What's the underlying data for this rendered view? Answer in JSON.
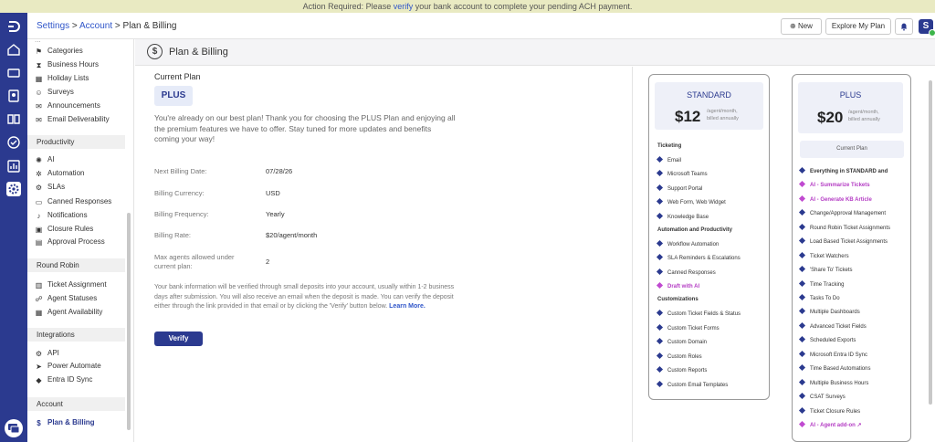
{
  "banner": {
    "prefix": "Action Required: Please ",
    "link": "verify",
    "suffix": " your bank account to complete your pending ACH payment."
  },
  "breadcrumb": {
    "settings": "Settings",
    "sep1": " > ",
    "account": "Account",
    "sep2": " > ",
    "current": "Plan & Billing"
  },
  "topbar": {
    "new_label": "⊕ New",
    "explore_label": "Explore My Plan",
    "avatar_letter": "S"
  },
  "sidebar": {
    "top_partial": "...",
    "items_top": [
      "Categories",
      "Business Hours",
      "Holiday Lists",
      "Surveys",
      "Announcements",
      "Email Deliverability"
    ],
    "productivity_title": "Productivity",
    "productivity_items": [
      "AI",
      "Automation",
      "SLAs",
      "Canned Responses",
      "Notifications",
      "Closure Rules",
      "Approval Process"
    ],
    "roundrobin_title": "Round Robin",
    "roundrobin_items": [
      "Ticket Assignment",
      "Agent Statuses",
      "Agent Availability"
    ],
    "integrations_title": "Integrations",
    "integrations_items": [
      "API",
      "Power Automate",
      "Entra ID Sync"
    ],
    "account_title": "Account",
    "account_items": [
      "Plan & Billing"
    ]
  },
  "page": {
    "title": "Plan & Billing"
  },
  "current_plan": {
    "heading": "Current Plan",
    "badge": "PLUS",
    "description": "You're already on our best plan! Thank you for choosing the PLUS Plan and enjoying all the premium features we have to offer. Stay tuned for more updates and benefits coming your way!",
    "fields": [
      {
        "label": "Next Billing Date:",
        "value": "07/28/26"
      },
      {
        "label": "Billing Currency:",
        "value": "USD"
      },
      {
        "label": "Billing Frequency:",
        "value": "Yearly"
      },
      {
        "label": "Billing Rate:",
        "value": "$20/agent/month"
      },
      {
        "label": "Max agents allowed under current plan:",
        "value": "2"
      }
    ],
    "note": "Your bank information will be verified through small deposits into your account, usually within 1-2 business days after submission. You will also receive an email when the deposit is made. You can verify the deposit either through the link provided in that email or by clicking the 'Verify' button below. ",
    "learn_more": "Learn More.",
    "verify_label": "Verify"
  },
  "plans": {
    "standard": {
      "name": "STANDARD",
      "price": "$12",
      "per1": "/agent/month,",
      "per2": "billed annually",
      "sections": [
        {
          "title": "Ticketing",
          "items": [
            "Email",
            "Microsoft Teams",
            "Support Portal",
            "Web Form, Web Widget",
            "Knowledge Base"
          ]
        },
        {
          "title": "Automation and Productivity",
          "items": [
            "Workflow Automation",
            "SLA Reminders & Escalations",
            "Canned Responses",
            "Draft with AI"
          ]
        },
        {
          "title": "Customizations",
          "items": [
            "Custom Ticket Fields & Status",
            "Custom Ticket Forms",
            "Custom Domain",
            "Custom Roles",
            "Custom Reports",
            "Custom Email Templates"
          ]
        }
      ]
    },
    "plus": {
      "name": "PLUS",
      "price": "$20",
      "per1": "/agent/month,",
      "per2": "billed annually",
      "current_label": "Current Plan",
      "items": [
        "Everything in STANDARD and",
        "AI - Summarize Tickets",
        "AI - Generate KB Article",
        "Change/Approval Management",
        "Round Robin Ticket Assignments",
        "Load Based Ticket Assignments",
        "Ticket Watchers",
        "'Share To' Tickets",
        "Time Tracking",
        "Tasks To Do",
        "Multiple Dashboards",
        "Advanced Ticket Fields",
        "Scheduled Exports",
        "Microsoft Entra ID Sync",
        "Time Based Automations",
        "Multiple Business Hours",
        "CSAT Surveys",
        "Ticket Closure Rules",
        "AI - Agent add-on"
      ],
      "ai_extra": "↗"
    }
  },
  "colors": {
    "brand": "#2b3a8f",
    "ai": "#b43cc4",
    "banner_bg": "#e9eac2"
  }
}
